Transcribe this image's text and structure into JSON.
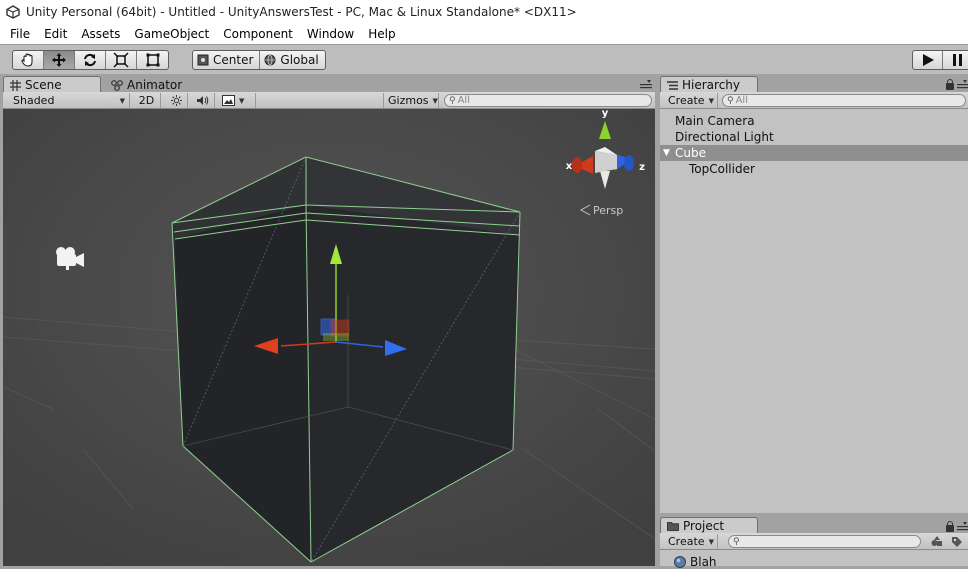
{
  "window": {
    "title": "Unity Personal (64bit) - Untitled - UnityAnswersTest - PC, Mac & Linux Standalone* <DX11>"
  },
  "menu": [
    "File",
    "Edit",
    "Assets",
    "GameObject",
    "Component",
    "Window",
    "Help"
  ],
  "toolbar": {
    "tools": [
      "hand-tool",
      "move-tool",
      "rotate-tool",
      "scale-tool",
      "rect-tool"
    ],
    "active_tool": "move-tool",
    "pivot_label": "Center",
    "space_label": "Global"
  },
  "scene_tabs": {
    "scene": "Scene",
    "animator": "Animator"
  },
  "scene_toolbar": {
    "shading": "Shaded",
    "mode_2d": "2D",
    "gizmos": "Gizmos",
    "search_placeholder": "All"
  },
  "scene_view": {
    "persp_label": "Persp",
    "axis_labels": {
      "x": "x",
      "y": "y",
      "z": "z"
    },
    "colors": {
      "x": "#d23a1e",
      "y": "#8fd12e",
      "z": "#2f62e0",
      "wire": "#8fd18f"
    }
  },
  "hierarchy": {
    "tab": "Hierarchy",
    "create": "Create",
    "search_placeholder": "All",
    "items": [
      {
        "label": "Main Camera",
        "depth": 0,
        "selected": false,
        "foldout": false
      },
      {
        "label": "Directional Light",
        "depth": 0,
        "selected": false,
        "foldout": false
      },
      {
        "label": "Cube",
        "depth": 0,
        "selected": true,
        "foldout": true
      },
      {
        "label": "TopCollider",
        "depth": 1,
        "selected": false,
        "foldout": false
      }
    ]
  },
  "project": {
    "tab": "Project",
    "create": "Create",
    "first_item": "Blah"
  }
}
